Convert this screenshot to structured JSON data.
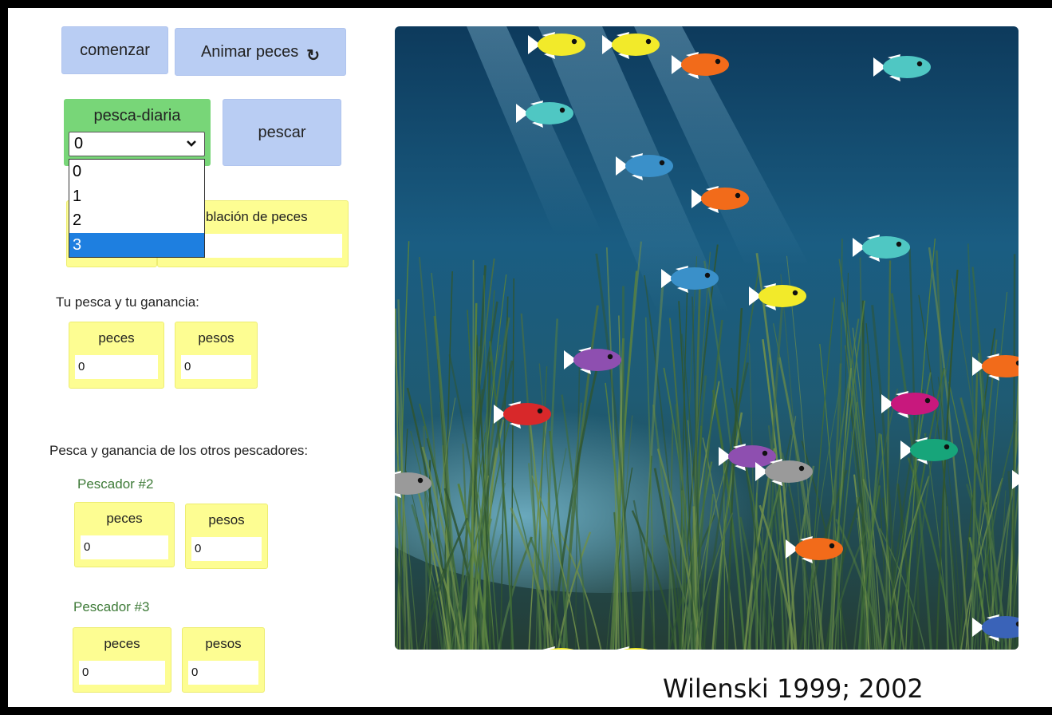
{
  "buttons": {
    "start": "comenzar",
    "animate": "Animar peces",
    "fish": "pescar"
  },
  "chooser": {
    "label": "pesca-diaria",
    "selected": "0",
    "options": [
      "0",
      "1",
      "2",
      "3"
    ],
    "highlighted": "3"
  },
  "population": {
    "label_visible": "blación de peces"
  },
  "your_section": {
    "title": "Tu pesca y tu ganancia:",
    "fish_label": "peces",
    "fish_value": "0",
    "money_label": "pesos",
    "money_value": "0"
  },
  "others_section": {
    "title": "Pesca y ganancia de los otros pescadores:",
    "fishers": [
      {
        "name": "Pescador #2",
        "fish_label": "peces",
        "fish_value": "0",
        "money_label": "pesos",
        "money_value": "0"
      },
      {
        "name": "Pescador #3",
        "fish_label": "peces",
        "fish_value": "0",
        "money_label": "pesos",
        "money_value": "0"
      }
    ]
  },
  "icons": {
    "animate": "refresh-icon",
    "select": "chevron-down-icon"
  },
  "colors": {
    "button": "#b9cdf3",
    "chooser": "#78d678",
    "monitor": "#fdfd92",
    "selected_option": "#1e7fe0",
    "fisher_label": "#3d7a37"
  },
  "credit": "Wilenski 1999; 2002"
}
